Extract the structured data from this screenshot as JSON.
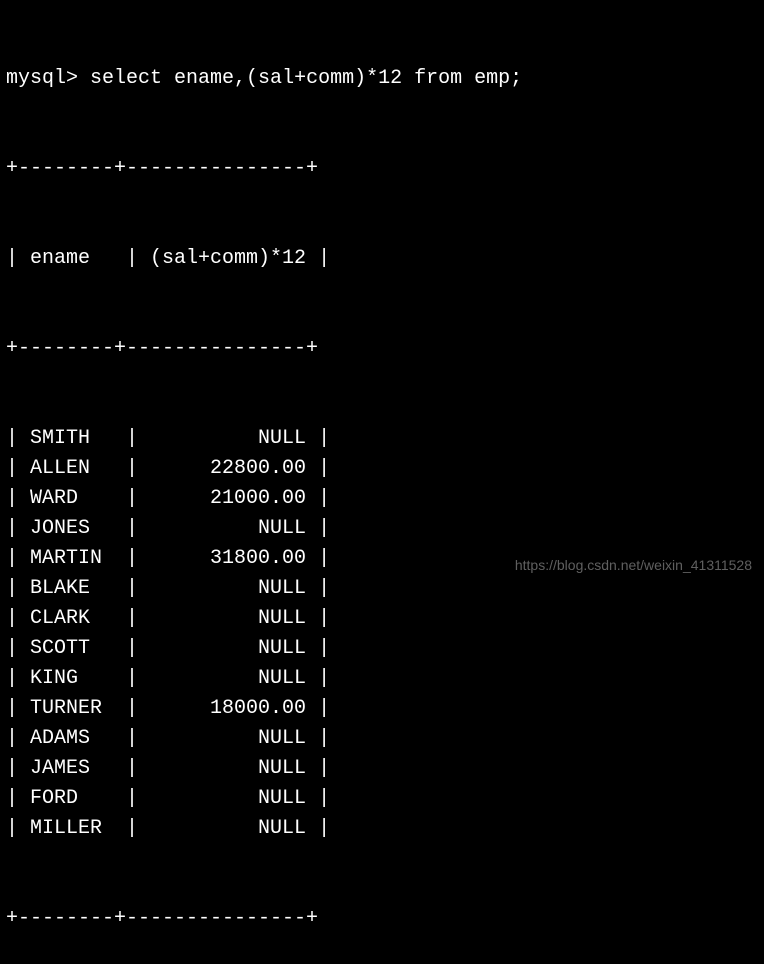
{
  "prompt": "mysql>",
  "query": "select ename,(sal+comm)*12 from emp;",
  "divider_top": "+--------+---------------+",
  "divider_mid": "+--------+---------------+",
  "divider_bot": "+--------+---------------+",
  "columns": {
    "col1": "ename",
    "col2": "(sal+comm)*12"
  },
  "rows": [
    {
      "ename": "SMITH",
      "val": "NULL"
    },
    {
      "ename": "ALLEN",
      "val": "22800.00"
    },
    {
      "ename": "WARD",
      "val": "21000.00"
    },
    {
      "ename": "JONES",
      "val": "NULL"
    },
    {
      "ename": "MARTIN",
      "val": "31800.00"
    },
    {
      "ename": "BLAKE",
      "val": "NULL"
    },
    {
      "ename": "CLARK",
      "val": "NULL"
    },
    {
      "ename": "SCOTT",
      "val": "NULL"
    },
    {
      "ename": "KING",
      "val": "NULL"
    },
    {
      "ename": "TURNER",
      "val": "18000.00"
    },
    {
      "ename": "ADAMS",
      "val": "NULL"
    },
    {
      "ename": "JAMES",
      "val": "NULL"
    },
    {
      "ename": "FORD",
      "val": "NULL"
    },
    {
      "ename": "MILLER",
      "val": "NULL"
    }
  ],
  "watermark": "https://blog.csdn.net/weixin_41311528"
}
